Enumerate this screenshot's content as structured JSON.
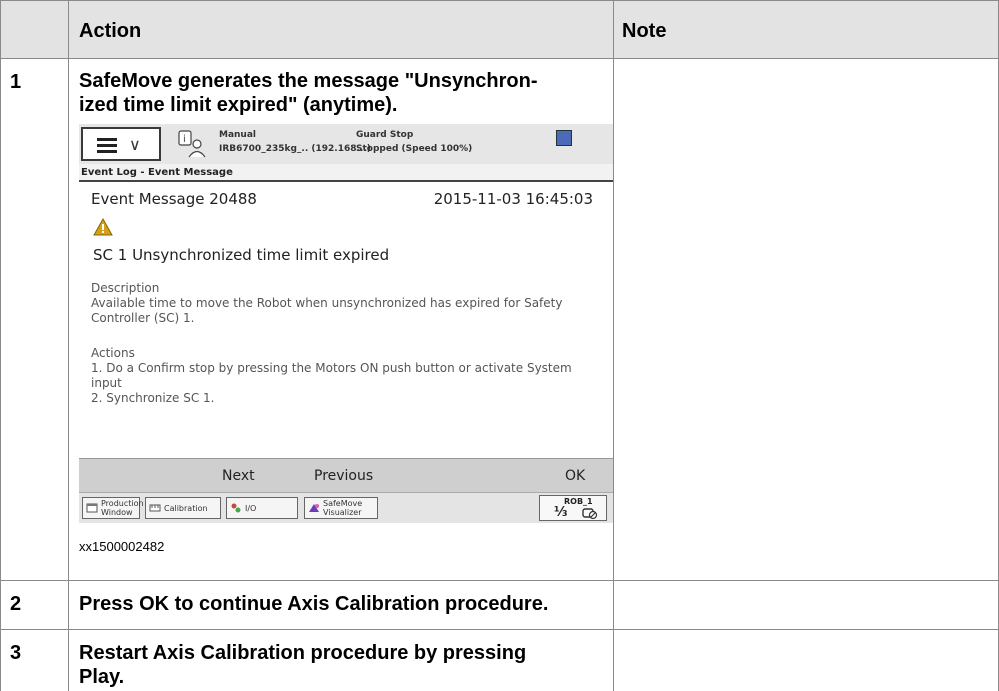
{
  "header": {
    "action": "Action",
    "note": "Note"
  },
  "steps": [
    {
      "number": "1",
      "text": "SafeMove generates the message \"Unsynchron-ized time limit expired\" (anytime).",
      "line1": "SafeMove generates the message \"Unsynchron-",
      "line2": "ized time limit expired\" (anytime)."
    },
    {
      "number": "2",
      "pre": "Press ",
      "bold": "OK",
      "post": " to continue Axis Calibration procedure."
    },
    {
      "number": "3",
      "line1": "Restart Axis Calibration procedure by pressing",
      "bold": "Play",
      "post": "."
    }
  ],
  "screenshot": {
    "status": {
      "mode": "Manual",
      "robot": "IRB6700_235kg_.. (192.168...)",
      "state": "Guard Stop",
      "speed": "Stopped (Speed 100%)"
    },
    "breadcrumb": "Event Log - Event Message",
    "event_title": "Event Message 20488",
    "event_date": "2015-11-03 16:45:03",
    "event_heading": "SC 1 Unsynchronized time limit expired",
    "description_label": "Description",
    "description_line1": "Available time to move the Robot when unsynchronized has expired for Safety",
    "description_line2": "Controller (SC) 1.",
    "actions_label": "Actions",
    "action_line1": "1. Do a Confirm stop by pressing the Motors ON push button or activate System",
    "action_line2": "input",
    "action_line3": "2. Synchronize SC 1.",
    "commands": {
      "next": "Next",
      "previous": "Previous",
      "ok": "OK"
    },
    "taskbar": {
      "production_1": "Production",
      "production_2": "Window",
      "calibration": "Calibration",
      "io": "I/O",
      "safemove_1": "SafeMove",
      "safemove_2": "Visualizer",
      "rob": "ROB_1",
      "fraction": "⅓"
    },
    "caption": "xx1500002482"
  },
  "colors": {
    "header_bg": "#e3e3e3",
    "grid": "#8a8a8a",
    "warning": "#d4a017"
  },
  "icons": {
    "menu": "hamburger-icon",
    "user": "person-info-icon",
    "warning": "warning-triangle-icon"
  }
}
